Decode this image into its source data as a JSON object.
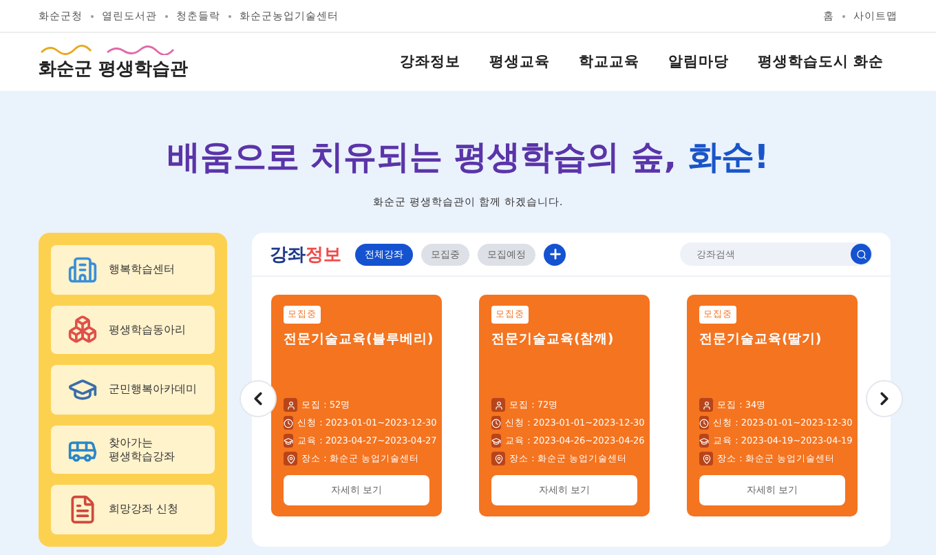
{
  "top_links": [
    "화순군청",
    "열린도서관",
    "청춘들락",
    "화순군농업기술센터"
  ],
  "top_right_links": [
    "홈",
    "사이트맵"
  ],
  "logo": {
    "title": "화순군 평생학습관"
  },
  "nav": [
    "강좌정보",
    "평생교육",
    "학교교육",
    "알림마당",
    "평생학습도시 화순"
  ],
  "hero": {
    "headline": "배움으로 치유되는 평생학습의 숲, ",
    "highlight": "화순!",
    "subtitle": "화순군 평생학습관이 함께 하겠습니다."
  },
  "quick_menu": [
    {
      "kind": "building",
      "label": "행복학습센터"
    },
    {
      "kind": "blocks",
      "label": "평생학습동아리"
    },
    {
      "kind": "cap",
      "label": "군민행복아카데미"
    },
    {
      "kind": "bus",
      "label": "찾아가는\n평생학습강좌"
    },
    {
      "kind": "document",
      "label": "희망강좌 신청"
    }
  ],
  "courses": {
    "title": "강좌",
    "title_accent": "정보",
    "filters": [
      {
        "label": "전체강좌",
        "selected": true
      },
      {
        "label": "모집중",
        "selected": false
      },
      {
        "label": "모집예정",
        "selected": false
      }
    ],
    "search": {
      "placeholder": "강좌검색"
    },
    "cards": [
      {
        "badge": "모집중",
        "title": "전문기술교육(블루베리)",
        "info": [
          {
            "kind": "user",
            "text": "모집 : 52명"
          },
          {
            "kind": "clock",
            "text": "신청 : 2023-01-01~2023-12-30"
          },
          {
            "kind": "cap",
            "text": "교육 : 2023-04-27~2023-04-27"
          },
          {
            "kind": "pin",
            "text": "장소 : 화순군 농업기술센터"
          }
        ],
        "button": "자세히 보기"
      },
      {
        "badge": "모집중",
        "title": "전문기술교육(참깨)",
        "info": [
          {
            "kind": "user",
            "text": "모집 : 72명"
          },
          {
            "kind": "clock",
            "text": "신청 : 2023-01-01~2023-12-30"
          },
          {
            "kind": "cap",
            "text": "교육 : 2023-04-26~2023-04-26"
          },
          {
            "kind": "pin",
            "text": "장소 : 화순군 농업기술센터"
          }
        ],
        "button": "자세히 보기"
      },
      {
        "badge": "모집중",
        "title": "전문기술교육(딸기)",
        "info": [
          {
            "kind": "user",
            "text": "모집 : 34명"
          },
          {
            "kind": "clock",
            "text": "신청 : 2023-01-01~2023-12-30"
          },
          {
            "kind": "cap",
            "text": "교육 : 2023-04-19~2023-04-19"
          },
          {
            "kind": "pin",
            "text": "장소 : 화순군 농업기술센터"
          }
        ],
        "button": "자세히 보기"
      }
    ]
  }
}
